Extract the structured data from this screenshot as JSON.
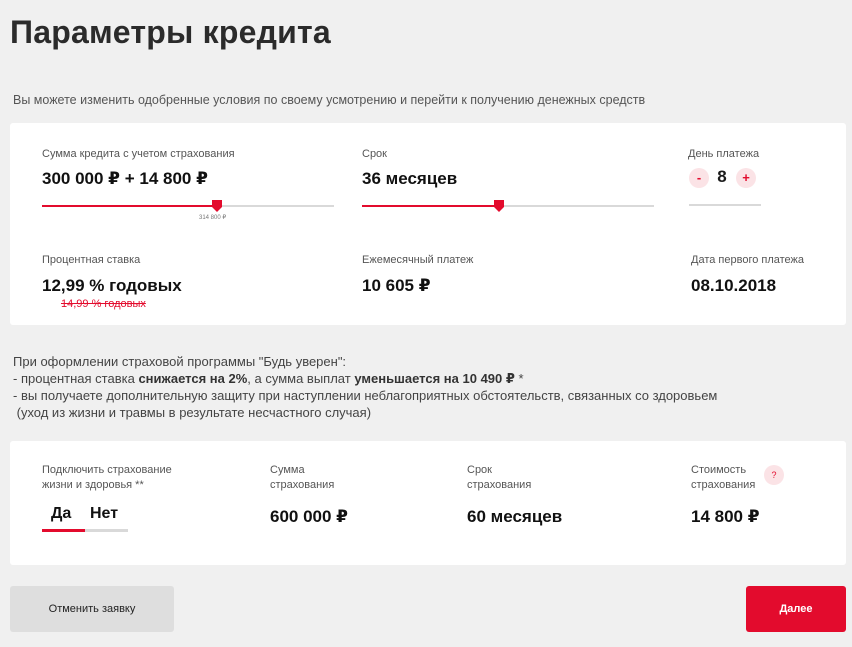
{
  "page": {
    "title": "Параметры кредита",
    "subtitle": "Вы можете изменить одобренные условия по своему усмотрению и перейти к получению денежных средств"
  },
  "params": {
    "amount": {
      "label": "Сумма кредита с учетом страхования",
      "value": "300 000 ₽ + 14 800 ₽",
      "tick": "314 800 ₽",
      "slider_fraction": 0.6
    },
    "term": {
      "label": "Срок",
      "value": "36 месяцев",
      "slider_fraction": 0.47
    },
    "payment_day": {
      "label": "День платежа",
      "minus": "-",
      "plus": "+",
      "value": "8"
    },
    "rate": {
      "label": "Процентная ставка",
      "value": "12,99 % годовых",
      "old_value": "14,99 % годовых"
    },
    "monthly": {
      "label": "Ежемесячный платеж",
      "value": "10 605 ₽"
    },
    "first_payment": {
      "label": "Дата первого платежа",
      "value": "08.10.2018"
    }
  },
  "promo": {
    "line1": "При оформлении страховой программы \"Будь уверен\":",
    "line2_a": "- процентная ставка ",
    "line2_b": "снижается на 2%",
    "line2_c": ", а сумма выплат ",
    "line2_d": "уменьшается на 10 490 ₽",
    "line2_e": " *",
    "line3": "- вы получаете дополнительную защиту при наступлении неблагоприятных обстоятельств, связанных со здоровьем",
    "line4": " (уход из жизни и травмы в результате несчастного случая)"
  },
  "insurance": {
    "connect_label_1": "Подключить страхование",
    "connect_label_2": "жизни и здоровья **",
    "yes": "Да",
    "no": "Нет",
    "selected": "Да",
    "sum_label_1": "Сумма",
    "sum_label_2": "страхования",
    "sum_value": "600 000 ₽",
    "term_label_1": "Срок",
    "term_label_2": "страхования",
    "term_value": "60 месяцев",
    "cost_label_1": "Стоимость",
    "cost_label_2": "страхования",
    "cost_value": "14 800 ₽",
    "help": "?"
  },
  "actions": {
    "cancel": "Отменить заявку",
    "next": "Далее"
  },
  "colors": {
    "accent": "#e30b2d",
    "background": "#f0f0f0"
  }
}
